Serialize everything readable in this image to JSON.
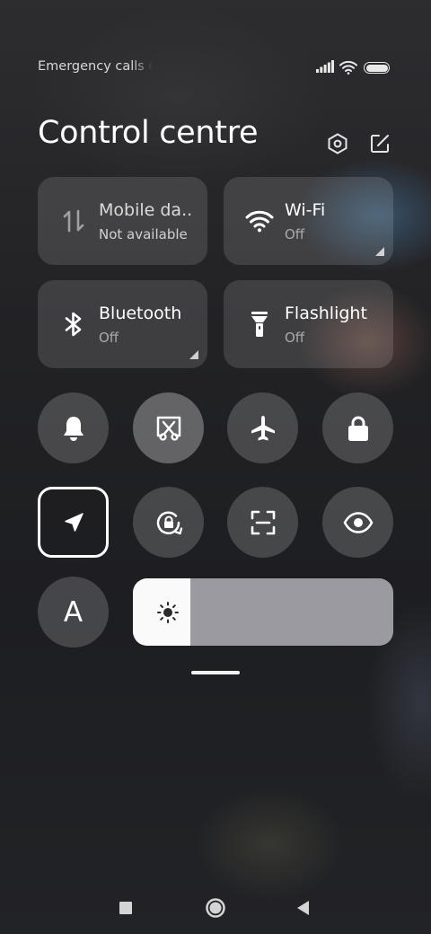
{
  "status_bar": {
    "carrier_text": "Emergency calls only",
    "icons": [
      "signal-icon",
      "wifi-icon",
      "battery-icon"
    ]
  },
  "header": {
    "title": "Control centre",
    "icons": [
      "settings-hexagon-icon",
      "edit-icon"
    ]
  },
  "tiles": {
    "mobile_data": {
      "label": "Mobile da..",
      "status": "Not available",
      "icon": "mobile-data-arrows-icon"
    },
    "wifi": {
      "label": "Wi-Fi",
      "status": "Off",
      "icon": "wifi-icon"
    },
    "bluetooth": {
      "label": "Bluetooth",
      "status": "Off",
      "icon": "bluetooth-icon"
    },
    "flashlight": {
      "label": "Flashlight",
      "status": "Off",
      "icon": "flashlight-icon"
    }
  },
  "toggles": {
    "row1": [
      "bell-icon",
      "screenshot-scissors-icon",
      "airplane-icon",
      "lock-icon"
    ],
    "row2": [
      "location-arrow-icon",
      "rotation-lock-icon",
      "scanner-icon",
      "eye-icon"
    ],
    "font_letter": "A"
  },
  "brightness": {
    "level": 0.22,
    "icon": "sun-icon"
  },
  "nav": [
    "recents-square-icon",
    "home-circle-icon",
    "back-triangle-icon"
  ],
  "colors": {
    "selected_border": "#ffffff",
    "tile_bg": "rgba(255,255,255,0.13)"
  }
}
